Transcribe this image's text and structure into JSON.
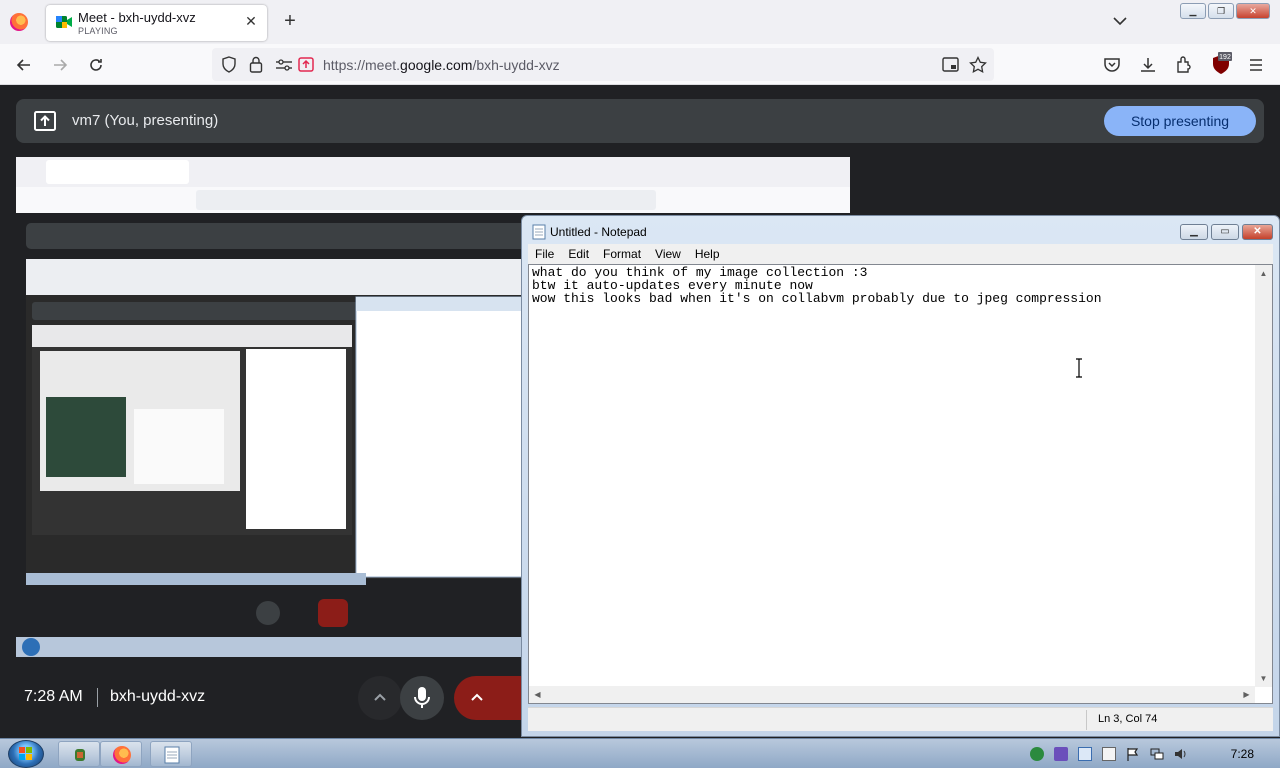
{
  "browser": {
    "tab": {
      "title": "Meet - bxh-uydd-xvz",
      "subtitle": "PLAYING"
    },
    "url": {
      "prefix": "https://meet.",
      "domain": "google.com",
      "path": "/bxh-uydd-xvz"
    },
    "notification_badge": "192"
  },
  "meet": {
    "presenting_label": "vm7 (You, presenting)",
    "stop_button": "Stop presenting",
    "time": "7:28 AM",
    "meeting_code": "bxh-uydd-xvz"
  },
  "notepad": {
    "title": "Untitled - Notepad",
    "menu": [
      "File",
      "Edit",
      "Format",
      "View",
      "Help"
    ],
    "content": "what do you think of my image collection :3\nbtw it auto-updates every minute now\nwow this looks bad when it's on collabvm probably due to jpeg compression",
    "status": "Ln 3, Col 74"
  },
  "taskbar": {
    "clock": "7:28"
  },
  "colors": {
    "meet_bg": "#202124",
    "meet_bar": "#3c4043",
    "stop_button_bg": "#8ab4f8",
    "end_call_red": "#8c1d18"
  }
}
